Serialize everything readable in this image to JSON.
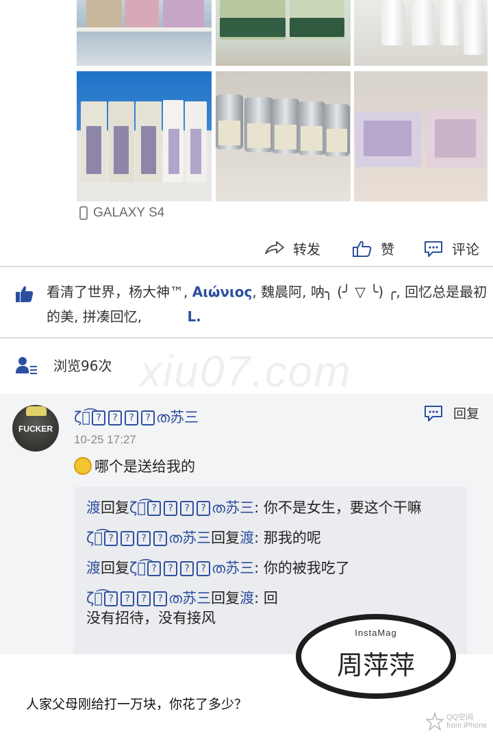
{
  "post": {
    "device": "GALAXY S4",
    "actions": {
      "share": "转发",
      "like": "赞",
      "comment": "评论"
    },
    "likers": {
      "prefix": "看清了世界，杨大神™, ",
      "bold": "Αιώνιος",
      "middle": ", 魏晨阿, 呐╮ (╯ ▽ ╰) ╭, 回忆总是最初的美, 拼凑回忆, ",
      "tail": "L."
    },
    "views": "浏览96次"
  },
  "watermark": "xiu07.com",
  "comment": {
    "avatar_text": "FUCKER",
    "author_prefix": "ζั͡",
    "author_suffix": "ത苏三",
    "qbox_char": "?",
    "time": "10-25 17:27",
    "text": "哪个是送给我的",
    "reply_label": "回复",
    "replies": [
      {
        "from": "渡",
        "verb": "回复",
        "to": "苏三",
        "text": ": 你不是女生，要这个干嘛"
      },
      {
        "from": "苏三",
        "verb": "回复",
        "to": "渡",
        "text": ": 那我的呢"
      },
      {
        "from": "渡",
        "verb": "回复",
        "to": "苏三",
        "text": ": 你的被我吃了"
      },
      {
        "from": "苏三",
        "verb": "回复",
        "to": "渡",
        "text": ": 回"
      },
      {
        "from": "",
        "verb": "",
        "to": "",
        "text": "没有招待，没有接风"
      }
    ]
  },
  "bottom": {
    "caption": "人家父母刚给打一万块，你花了多少？",
    "instamag_label": "InstaMag",
    "instamag_name": "周萍萍",
    "qq_brand": "QQ空间",
    "qq_sub": "from iPhone"
  },
  "colors": {
    "link": "#2c4f9e",
    "divider": "#d9dde3",
    "comment_bg": "#f3f4f6"
  }
}
